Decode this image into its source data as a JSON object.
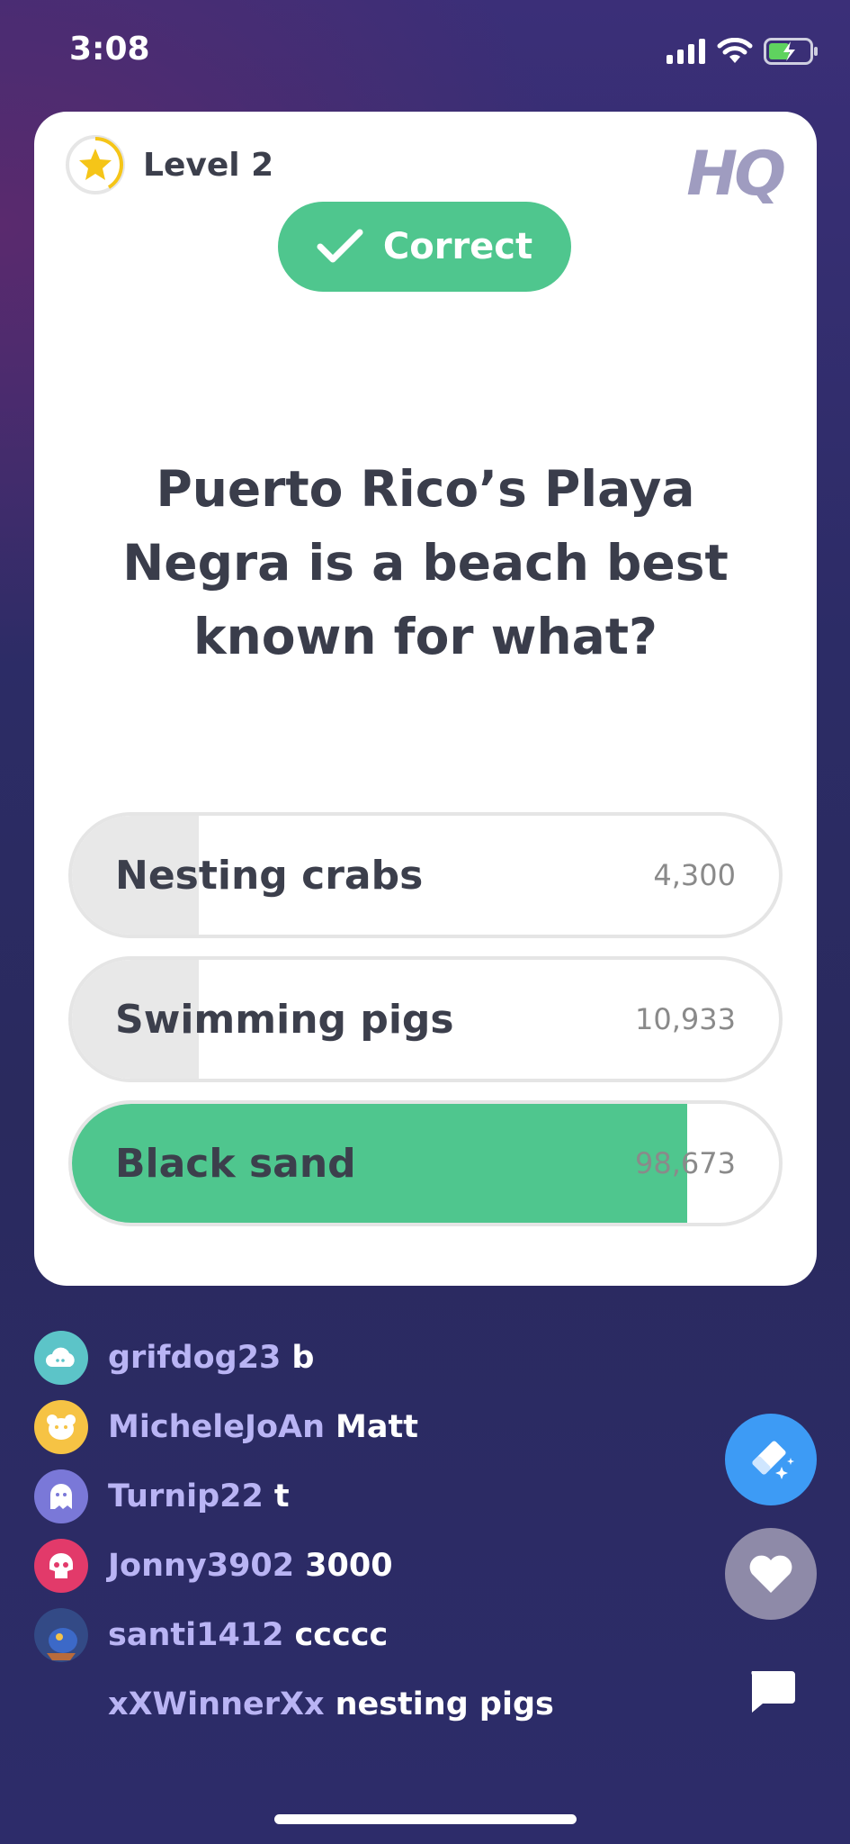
{
  "status_bar": {
    "time": "3:08"
  },
  "card": {
    "level_label": "Level 2",
    "logo": "HQ",
    "result_label": "Correct",
    "question": "Puerto Rico’s Playa Negra is a beach best known for what?",
    "answers": [
      {
        "label": "Nesting crabs",
        "count": "4,300",
        "fill_pct": 18,
        "correct": false
      },
      {
        "label": "Swimming pigs",
        "count": "10,933",
        "fill_pct": 18,
        "correct": false
      },
      {
        "label": "Black sand",
        "count": "98,673",
        "fill_pct": 87,
        "correct": true
      }
    ]
  },
  "chat": [
    {
      "user": "grifdog23",
      "message": "b",
      "avatar_icon": "cloud-icon",
      "avatar_color": "#5cc4c8"
    },
    {
      "user": "MicheleJoAn",
      "message": "Matt",
      "avatar_icon": "bear-icon",
      "avatar_color": "#f6c344"
    },
    {
      "user": "Turnip22",
      "message": "t",
      "avatar_icon": "ghost-icon",
      "avatar_color": "#7a78d8"
    },
    {
      "user": "Jonny3902",
      "message": "3000",
      "avatar_icon": "skull-icon",
      "avatar_color": "#e23a6a"
    },
    {
      "user": "santi1412",
      "message": "ccccc",
      "avatar_icon": "photo-avatar",
      "avatar_color": "#2a3a6a"
    },
    {
      "user": "xXWinnerXx",
      "message": "nesting pigs",
      "avatar_icon": "",
      "avatar_color": ""
    }
  ],
  "actions": {
    "eraser_icon": "eraser-icon",
    "heart_icon": "heart-icon",
    "chat_icon": "chat-bubble-icon"
  },
  "colors": {
    "correct_green": "#4fc68e",
    "eraser_blue": "#3d9bf5",
    "username_purple": "#b9b4f4"
  }
}
